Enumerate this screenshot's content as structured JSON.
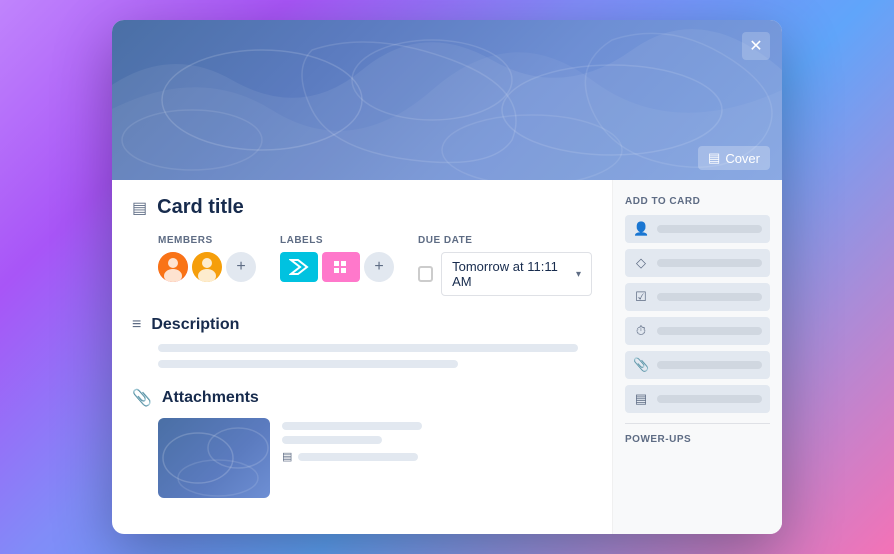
{
  "modal": {
    "close_label": "✕",
    "cover_button_label": "Cover"
  },
  "card": {
    "title": "Card title",
    "title_icon": "▤"
  },
  "members": {
    "label": "MEMBERS",
    "add_button": "+"
  },
  "labels": {
    "label": "LABELS",
    "add_button": "+"
  },
  "due_date": {
    "label": "DUE DATE",
    "value": "Tomorrow at 11:11 AM"
  },
  "description": {
    "title": "Description"
  },
  "attachments": {
    "title": "Attachments"
  },
  "sidebar": {
    "add_to_card_label": "ADD TO CARD",
    "buttons": [
      {
        "id": "members",
        "icon": "👤",
        "label": ""
      },
      {
        "id": "labels",
        "icon": "🏷",
        "label": ""
      },
      {
        "id": "checklist",
        "icon": "✓",
        "label": ""
      },
      {
        "id": "dates",
        "icon": "🕐",
        "label": ""
      },
      {
        "id": "attachment",
        "icon": "📎",
        "label": ""
      },
      {
        "id": "cover",
        "icon": "▤",
        "label": ""
      }
    ],
    "power_ups_label": "POWER-UPS"
  }
}
